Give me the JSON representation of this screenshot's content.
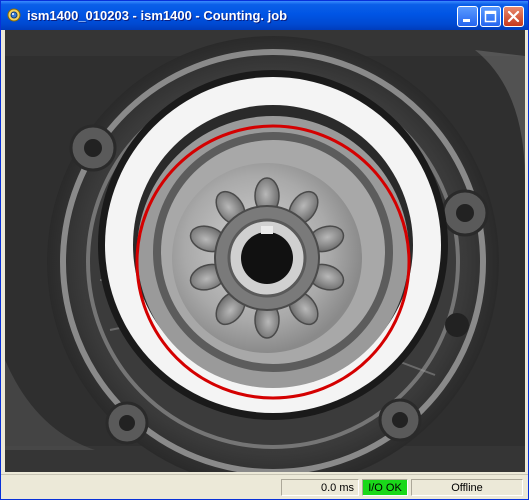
{
  "window": {
    "title": "ism1400_010203 - ism1400 - Counting. job",
    "app_icon": "camera-icon"
  },
  "titlebar_buttons": {
    "minimize": "minimize-icon",
    "maximize": "maximize-icon",
    "close": "close-icon"
  },
  "image_view": {
    "overlay_color": "#d40000",
    "overlay_shape": "circle"
  },
  "statusbar": {
    "time": "0.0 ms",
    "io_status": "I/O OK",
    "io_color": "#1ad81a",
    "connection": "Offline"
  }
}
